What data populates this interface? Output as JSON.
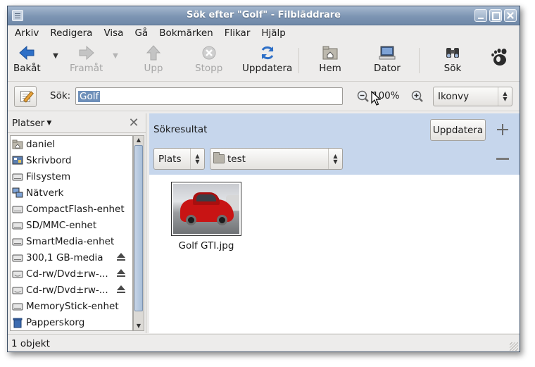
{
  "window": {
    "title": "Sök efter \"Golf\" - Filbläddrare"
  },
  "menubar": [
    "Arkiv",
    "Redigera",
    "Visa",
    "Gå",
    "Bokmärken",
    "Flikar",
    "Hjälp"
  ],
  "toolbar": {
    "back": "Bakåt",
    "forward": "Framåt",
    "up": "Upp",
    "stop": "Stopp",
    "reload": "Uppdatera",
    "home": "Hem",
    "computer": "Dator",
    "search": "Sök"
  },
  "searchbar": {
    "label": "Sök:",
    "value": "Golf",
    "zoom": "100%",
    "view": "Ikonvy"
  },
  "sidebar": {
    "title": "Platser",
    "items": [
      {
        "label": "daniel",
        "icon": "home-folder-icon"
      },
      {
        "label": "Skrivbord",
        "icon": "desktop-icon"
      },
      {
        "label": "Filsystem",
        "icon": "drive-icon"
      },
      {
        "label": "Nätverk",
        "icon": "network-icon"
      },
      {
        "label": "CompactFlash-enhet",
        "icon": "drive-icon"
      },
      {
        "label": "SD/MMC-enhet",
        "icon": "drive-icon"
      },
      {
        "label": "SmartMedia-enhet",
        "icon": "drive-icon"
      },
      {
        "label": "300,1 GB-media",
        "icon": "drive-icon",
        "eject": true
      },
      {
        "label": "Cd-rw/Dvd±rw-...",
        "icon": "optical-drive-icon",
        "eject": true
      },
      {
        "label": "Cd-rw/Dvd±rw-...",
        "icon": "optical-drive-icon",
        "eject": true
      },
      {
        "label": "MemoryStick-enhet",
        "icon": "drive-icon"
      },
      {
        "label": "Papperskorg",
        "icon": "trash-icon"
      }
    ]
  },
  "results": {
    "title": "Sökresultat",
    "update": "Uppdatera",
    "criterion": "Plats",
    "folder": "test",
    "files": [
      {
        "name": "Golf GTI.jpg"
      }
    ]
  },
  "status": {
    "text": "1 objekt"
  },
  "colors": {
    "titlebar": "#7d95b3",
    "header": "#c6d6ec",
    "selection": "#6e8fb9"
  }
}
